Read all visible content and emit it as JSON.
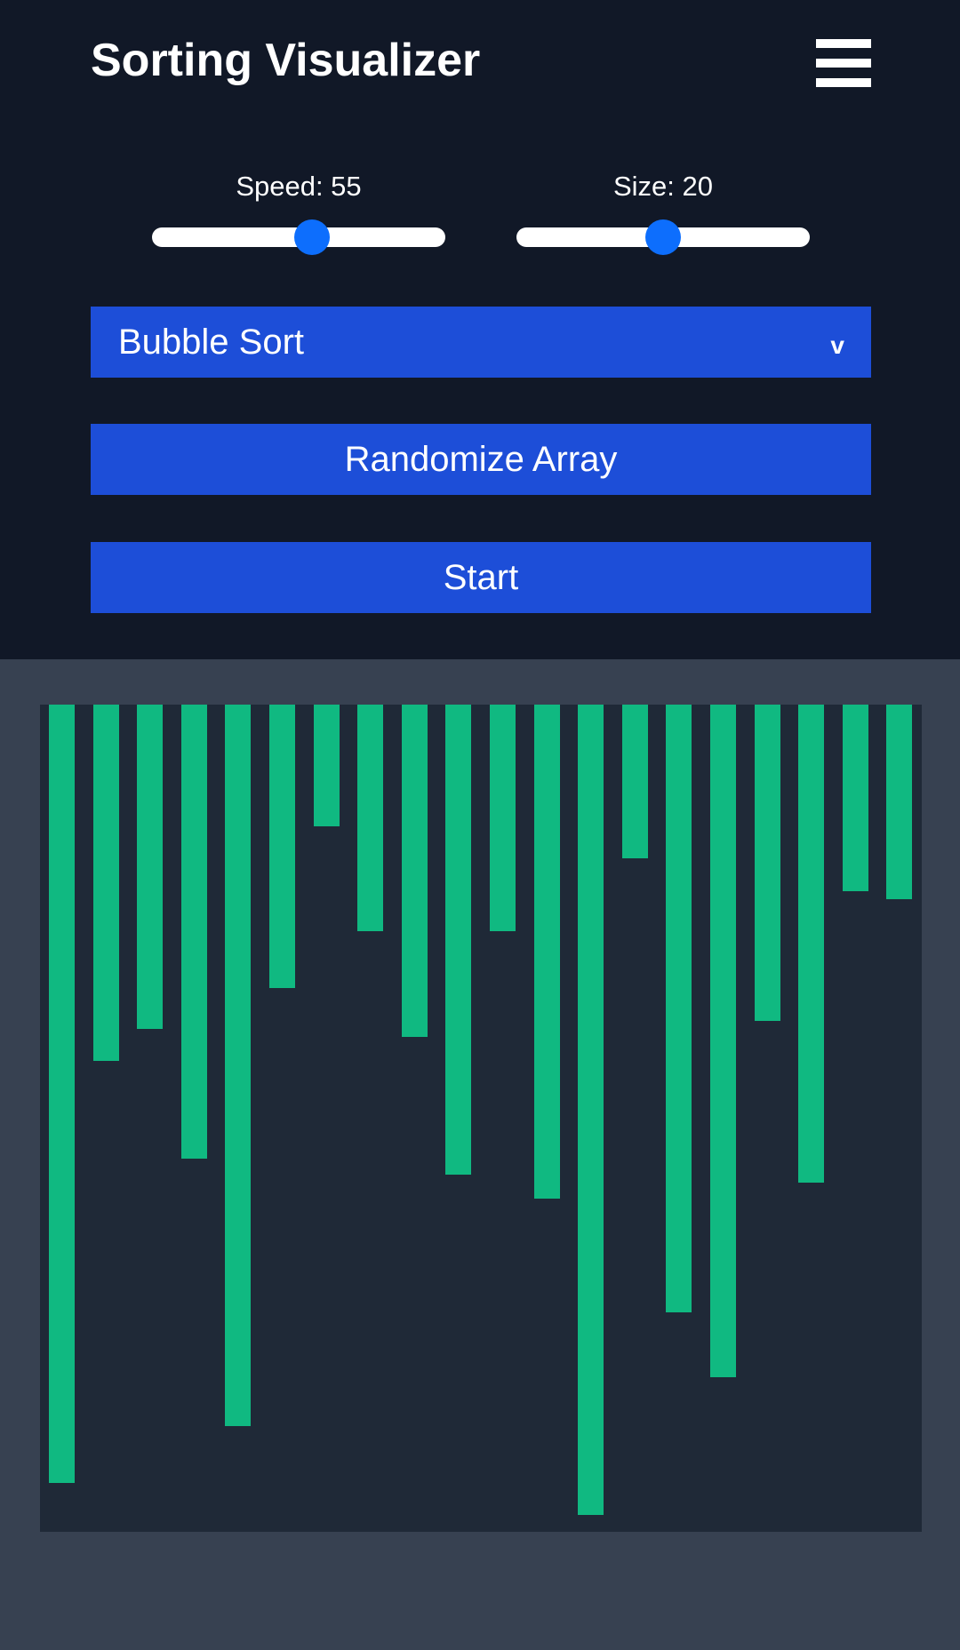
{
  "header": {
    "title": "Sorting Visualizer",
    "menu_icon": "hamburger-menu-icon"
  },
  "controls": {
    "speed": {
      "label": "Speed: 55",
      "value": 55,
      "min": 1,
      "max": 100
    },
    "size": {
      "label": "Size: 20",
      "value": 20,
      "min": 5,
      "max": 35
    },
    "algorithm": {
      "selected": "Bubble Sort",
      "caret": "v"
    },
    "randomize_label": "Randomize Array",
    "start_label": "Start"
  },
  "colors": {
    "header_bg": "#111827",
    "page_bg": "#374151",
    "panel_bg": "#1f2937",
    "button_bg": "#1d4ed8",
    "thumb": "#0d6efd",
    "bar": "#10b981"
  },
  "chart_data": {
    "type": "bar",
    "orientation": "downward",
    "values": [
      96,
      44,
      40,
      56,
      89,
      35,
      15,
      28,
      41,
      58,
      28,
      61,
      100,
      19,
      75,
      83,
      39,
      59,
      23,
      24
    ]
  }
}
